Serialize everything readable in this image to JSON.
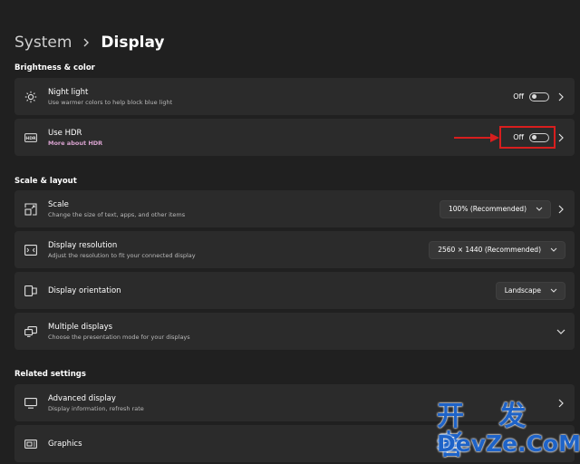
{
  "breadcrumb": {
    "parent": "System",
    "current": "Display"
  },
  "sections": {
    "brightness": "Brightness & color",
    "scale": "Scale & layout",
    "related": "Related settings"
  },
  "night_light": {
    "title": "Night light",
    "subtitle": "Use warmer colors to help block blue light",
    "state": "Off",
    "icon": "sun-icon"
  },
  "hdr": {
    "title": "Use HDR",
    "link": "More about HDR",
    "state": "Off",
    "icon": "hdr-icon"
  },
  "scale": {
    "title": "Scale",
    "subtitle": "Change the size of text, apps, and other items",
    "value": "100% (Recommended)",
    "icon": "scale-icon"
  },
  "resolution": {
    "title": "Display resolution",
    "subtitle": "Adjust the resolution to fit your connected display",
    "value": "2560 × 1440 (Recommended)",
    "icon": "resolution-icon"
  },
  "orientation": {
    "title": "Display orientation",
    "value": "Landscape",
    "icon": "orientation-icon"
  },
  "multiple": {
    "title": "Multiple displays",
    "subtitle": "Choose the presentation mode for your displays",
    "icon": "multiple-displays-icon"
  },
  "advanced": {
    "title": "Advanced display",
    "subtitle": "Display information, refresh rate",
    "icon": "monitor-icon"
  },
  "graphics": {
    "title": "Graphics",
    "icon": "graphics-icon"
  },
  "watermark": {
    "top": "开 发 者",
    "bottom": "DevZe.CoM"
  },
  "colors": {
    "background": "#202020",
    "card": "#2b2b2b",
    "highlight": "#d81e1e",
    "link": "#d8a2cf",
    "watermark": "#1e63c8"
  }
}
